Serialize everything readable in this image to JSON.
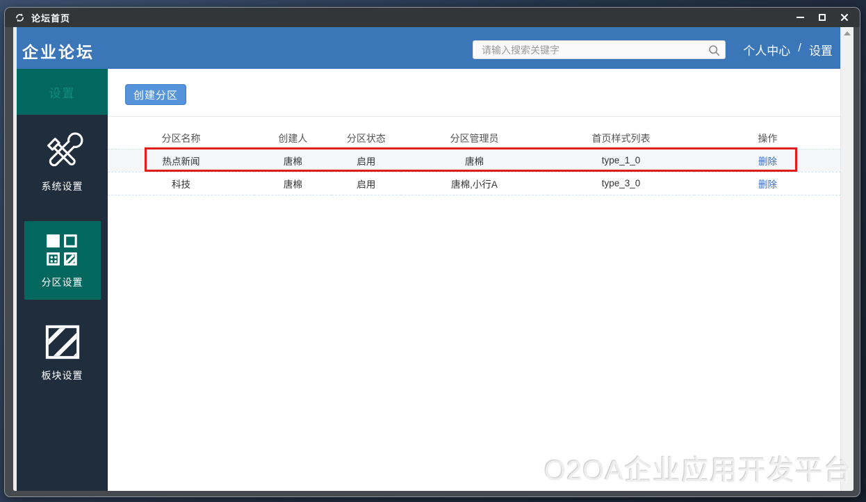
{
  "window": {
    "title": "论坛首页"
  },
  "header": {
    "app_title": "企业论坛",
    "search_placeholder": "请输入搜索关键字",
    "link_profile": "个人中心",
    "link_separator": "/",
    "link_settings": "设置"
  },
  "sidebar": {
    "section_title": "设置",
    "items": [
      {
        "label": "系统设置",
        "icon": "tools-icon",
        "active": false
      },
      {
        "label": "分区设置",
        "icon": "grid-squares-icon",
        "active": true
      },
      {
        "label": "板块设置",
        "icon": "striped-square-icon",
        "active": false
      }
    ]
  },
  "main": {
    "create_button": "创建分区",
    "table": {
      "columns": [
        "分区名称",
        "创建人",
        "分区状态",
        "分区管理员",
        "首页样式列表",
        "操作"
      ],
      "rows": [
        {
          "cells": [
            "热点新闻",
            "唐棉",
            "启用",
            "唐棉",
            "type_1_0"
          ],
          "action": "删除",
          "highlighted": true
        },
        {
          "cells": [
            "科技",
            "唐棉",
            "启用",
            "唐棉,小行A",
            "type_3_0"
          ],
          "action": "删除",
          "highlighted": false
        }
      ]
    },
    "watermark": "O2OA企业应用开发平台"
  },
  "colors": {
    "header_blue": "#3b76b8",
    "sidebar_dark": "#1f2d3c",
    "accent_teal": "#02685f",
    "annotation_red": "#e11d1d",
    "link_blue": "#3b6fc0"
  }
}
